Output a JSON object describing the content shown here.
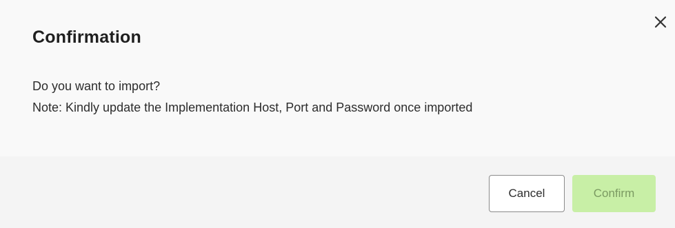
{
  "dialog": {
    "title": "Confirmation",
    "close_icon": "close-icon",
    "message_line1": "Do you want to import?",
    "message_line2": "Note: Kindly update the Implementation Host, Port and Password once imported"
  },
  "footer": {
    "cancel_label": "Cancel",
    "confirm_label": "Confirm"
  },
  "colors": {
    "confirm_button_bg": "#c8efa6",
    "confirm_button_text": "#7b9a62",
    "dialog_bg": "#f9f9f9"
  }
}
